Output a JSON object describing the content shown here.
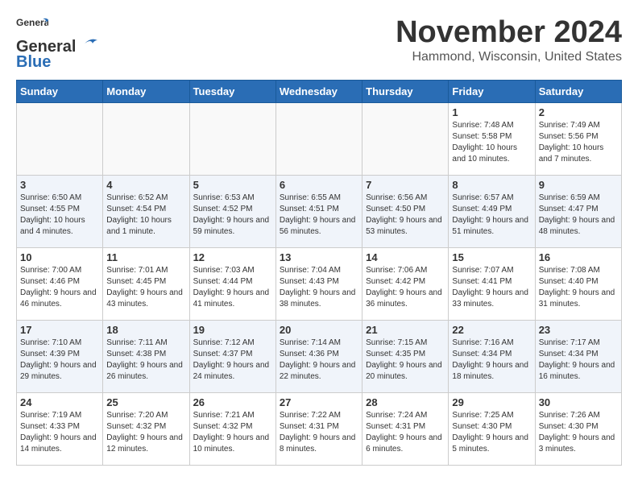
{
  "logo": {
    "general": "General",
    "blue": "Blue"
  },
  "title": "November 2024",
  "location": "Hammond, Wisconsin, United States",
  "days_of_week": [
    "Sunday",
    "Monday",
    "Tuesday",
    "Wednesday",
    "Thursday",
    "Friday",
    "Saturday"
  ],
  "weeks": [
    [
      {
        "day": "",
        "info": ""
      },
      {
        "day": "",
        "info": ""
      },
      {
        "day": "",
        "info": ""
      },
      {
        "day": "",
        "info": ""
      },
      {
        "day": "",
        "info": ""
      },
      {
        "day": "1",
        "info": "Sunrise: 7:48 AM\nSunset: 5:58 PM\nDaylight: 10 hours and 10 minutes."
      },
      {
        "day": "2",
        "info": "Sunrise: 7:49 AM\nSunset: 5:56 PM\nDaylight: 10 hours and 7 minutes."
      }
    ],
    [
      {
        "day": "3",
        "info": "Sunrise: 6:50 AM\nSunset: 4:55 PM\nDaylight: 10 hours and 4 minutes."
      },
      {
        "day": "4",
        "info": "Sunrise: 6:52 AM\nSunset: 4:54 PM\nDaylight: 10 hours and 1 minute."
      },
      {
        "day": "5",
        "info": "Sunrise: 6:53 AM\nSunset: 4:52 PM\nDaylight: 9 hours and 59 minutes."
      },
      {
        "day": "6",
        "info": "Sunrise: 6:55 AM\nSunset: 4:51 PM\nDaylight: 9 hours and 56 minutes."
      },
      {
        "day": "7",
        "info": "Sunrise: 6:56 AM\nSunset: 4:50 PM\nDaylight: 9 hours and 53 minutes."
      },
      {
        "day": "8",
        "info": "Sunrise: 6:57 AM\nSunset: 4:49 PM\nDaylight: 9 hours and 51 minutes."
      },
      {
        "day": "9",
        "info": "Sunrise: 6:59 AM\nSunset: 4:47 PM\nDaylight: 9 hours and 48 minutes."
      }
    ],
    [
      {
        "day": "10",
        "info": "Sunrise: 7:00 AM\nSunset: 4:46 PM\nDaylight: 9 hours and 46 minutes."
      },
      {
        "day": "11",
        "info": "Sunrise: 7:01 AM\nSunset: 4:45 PM\nDaylight: 9 hours and 43 minutes."
      },
      {
        "day": "12",
        "info": "Sunrise: 7:03 AM\nSunset: 4:44 PM\nDaylight: 9 hours and 41 minutes."
      },
      {
        "day": "13",
        "info": "Sunrise: 7:04 AM\nSunset: 4:43 PM\nDaylight: 9 hours and 38 minutes."
      },
      {
        "day": "14",
        "info": "Sunrise: 7:06 AM\nSunset: 4:42 PM\nDaylight: 9 hours and 36 minutes."
      },
      {
        "day": "15",
        "info": "Sunrise: 7:07 AM\nSunset: 4:41 PM\nDaylight: 9 hours and 33 minutes."
      },
      {
        "day": "16",
        "info": "Sunrise: 7:08 AM\nSunset: 4:40 PM\nDaylight: 9 hours and 31 minutes."
      }
    ],
    [
      {
        "day": "17",
        "info": "Sunrise: 7:10 AM\nSunset: 4:39 PM\nDaylight: 9 hours and 29 minutes."
      },
      {
        "day": "18",
        "info": "Sunrise: 7:11 AM\nSunset: 4:38 PM\nDaylight: 9 hours and 26 minutes."
      },
      {
        "day": "19",
        "info": "Sunrise: 7:12 AM\nSunset: 4:37 PM\nDaylight: 9 hours and 24 minutes."
      },
      {
        "day": "20",
        "info": "Sunrise: 7:14 AM\nSunset: 4:36 PM\nDaylight: 9 hours and 22 minutes."
      },
      {
        "day": "21",
        "info": "Sunrise: 7:15 AM\nSunset: 4:35 PM\nDaylight: 9 hours and 20 minutes."
      },
      {
        "day": "22",
        "info": "Sunrise: 7:16 AM\nSunset: 4:34 PM\nDaylight: 9 hours and 18 minutes."
      },
      {
        "day": "23",
        "info": "Sunrise: 7:17 AM\nSunset: 4:34 PM\nDaylight: 9 hours and 16 minutes."
      }
    ],
    [
      {
        "day": "24",
        "info": "Sunrise: 7:19 AM\nSunset: 4:33 PM\nDaylight: 9 hours and 14 minutes."
      },
      {
        "day": "25",
        "info": "Sunrise: 7:20 AM\nSunset: 4:32 PM\nDaylight: 9 hours and 12 minutes."
      },
      {
        "day": "26",
        "info": "Sunrise: 7:21 AM\nSunset: 4:32 PM\nDaylight: 9 hours and 10 minutes."
      },
      {
        "day": "27",
        "info": "Sunrise: 7:22 AM\nSunset: 4:31 PM\nDaylight: 9 hours and 8 minutes."
      },
      {
        "day": "28",
        "info": "Sunrise: 7:24 AM\nSunset: 4:31 PM\nDaylight: 9 hours and 6 minutes."
      },
      {
        "day": "29",
        "info": "Sunrise: 7:25 AM\nSunset: 4:30 PM\nDaylight: 9 hours and 5 minutes."
      },
      {
        "day": "30",
        "info": "Sunrise: 7:26 AM\nSunset: 4:30 PM\nDaylight: 9 hours and 3 minutes."
      }
    ]
  ]
}
